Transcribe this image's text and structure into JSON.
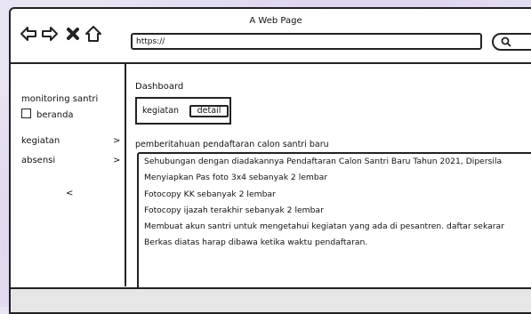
{
  "window": {
    "title": "A Web Page"
  },
  "nav": {
    "url": "https://"
  },
  "sidebar": {
    "app_title": "monitoring santri",
    "items": [
      {
        "label": "beranda",
        "type": "checkbox"
      },
      {
        "label": "kegiatan",
        "type": "submenu"
      },
      {
        "label": "absensi",
        "type": "submenu"
      }
    ],
    "collapse_glyph": "<",
    "submenu_glyph": ">"
  },
  "main": {
    "heading": "Dashboard",
    "card": {
      "label": "kegiatan",
      "button": "detail"
    },
    "announcement": {
      "title": "pemberitahuan pendaftaran calon santri baru",
      "lines": [
        "Sehubungan dengan diadakannya Pendaftaran Calon Santri Baru Tahun 2021, Dipersila",
        "Menyiapkan Pas foto 3x4 sebanyak 2 lembar",
        "Fotocopy KK sebanyak 2 lembar",
        "Fotocopy ijazah terakhir sebanyak 2 lembar",
        "Membuat akun santri untuk mengetahui kegiatan yang ada di pesantren. daftar sekarar",
        "Berkas diatas harap dibawa ketika waktu pendaftaran."
      ]
    }
  }
}
